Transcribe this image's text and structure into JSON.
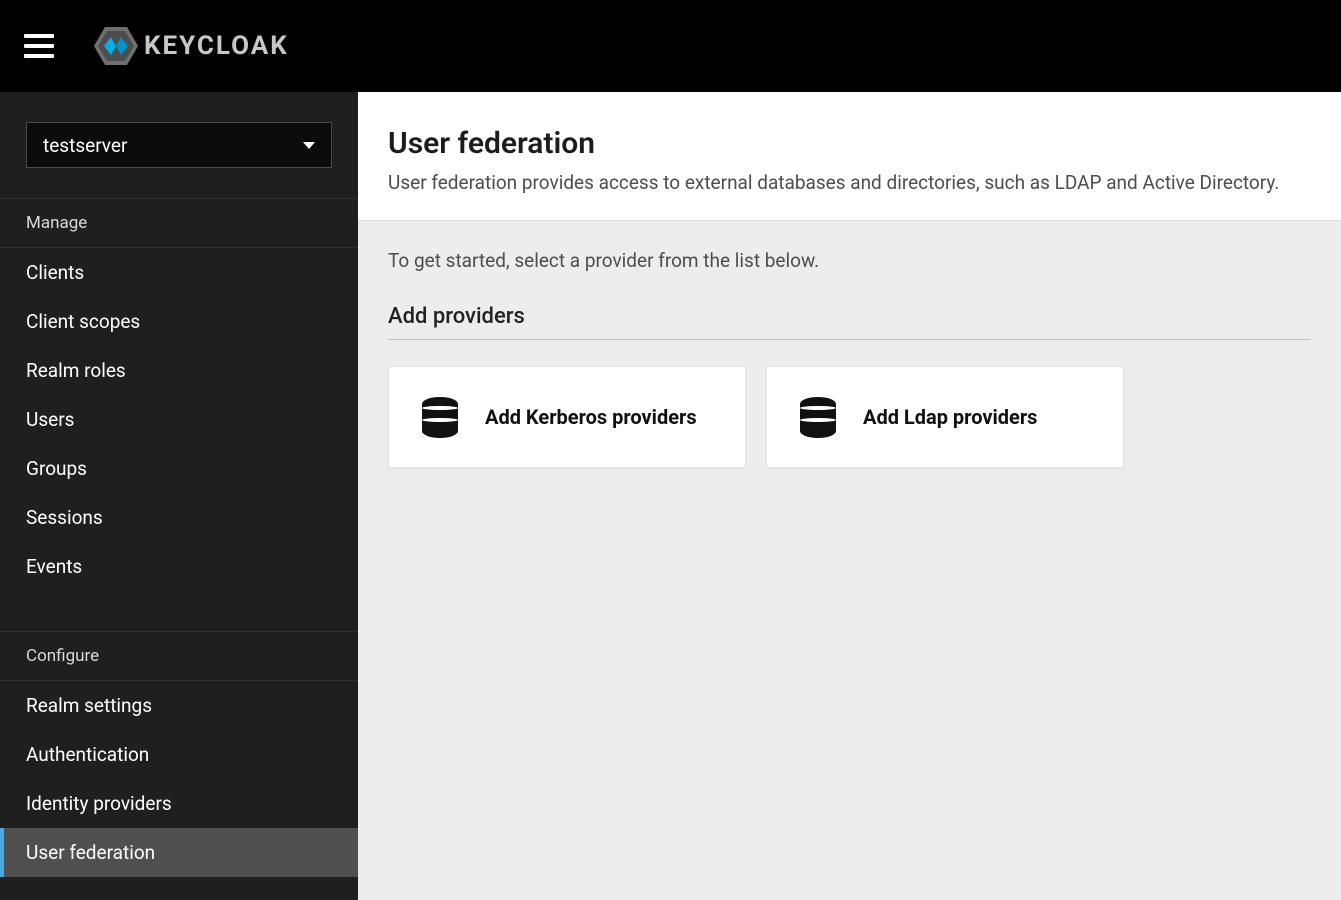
{
  "brand": {
    "name": "KEYCLOAK"
  },
  "realm": {
    "selected": "testserver"
  },
  "sidebar": {
    "manage_label": "Manage",
    "configure_label": "Configure",
    "manage_items": [
      {
        "label": "Clients"
      },
      {
        "label": "Client scopes"
      },
      {
        "label": "Realm roles"
      },
      {
        "label": "Users"
      },
      {
        "label": "Groups"
      },
      {
        "label": "Sessions"
      },
      {
        "label": "Events"
      }
    ],
    "configure_items": [
      {
        "label": "Realm settings"
      },
      {
        "label": "Authentication"
      },
      {
        "label": "Identity providers"
      },
      {
        "label": "User federation"
      }
    ]
  },
  "page": {
    "title": "User federation",
    "description": "User federation provides access to external databases and directories, such as LDAP and Active Directory.",
    "intro": "To get started, select a provider from the list below.",
    "add_section_title": "Add providers",
    "cards": [
      {
        "label": "Add Kerberos providers"
      },
      {
        "label": "Add Ldap providers"
      }
    ]
  }
}
